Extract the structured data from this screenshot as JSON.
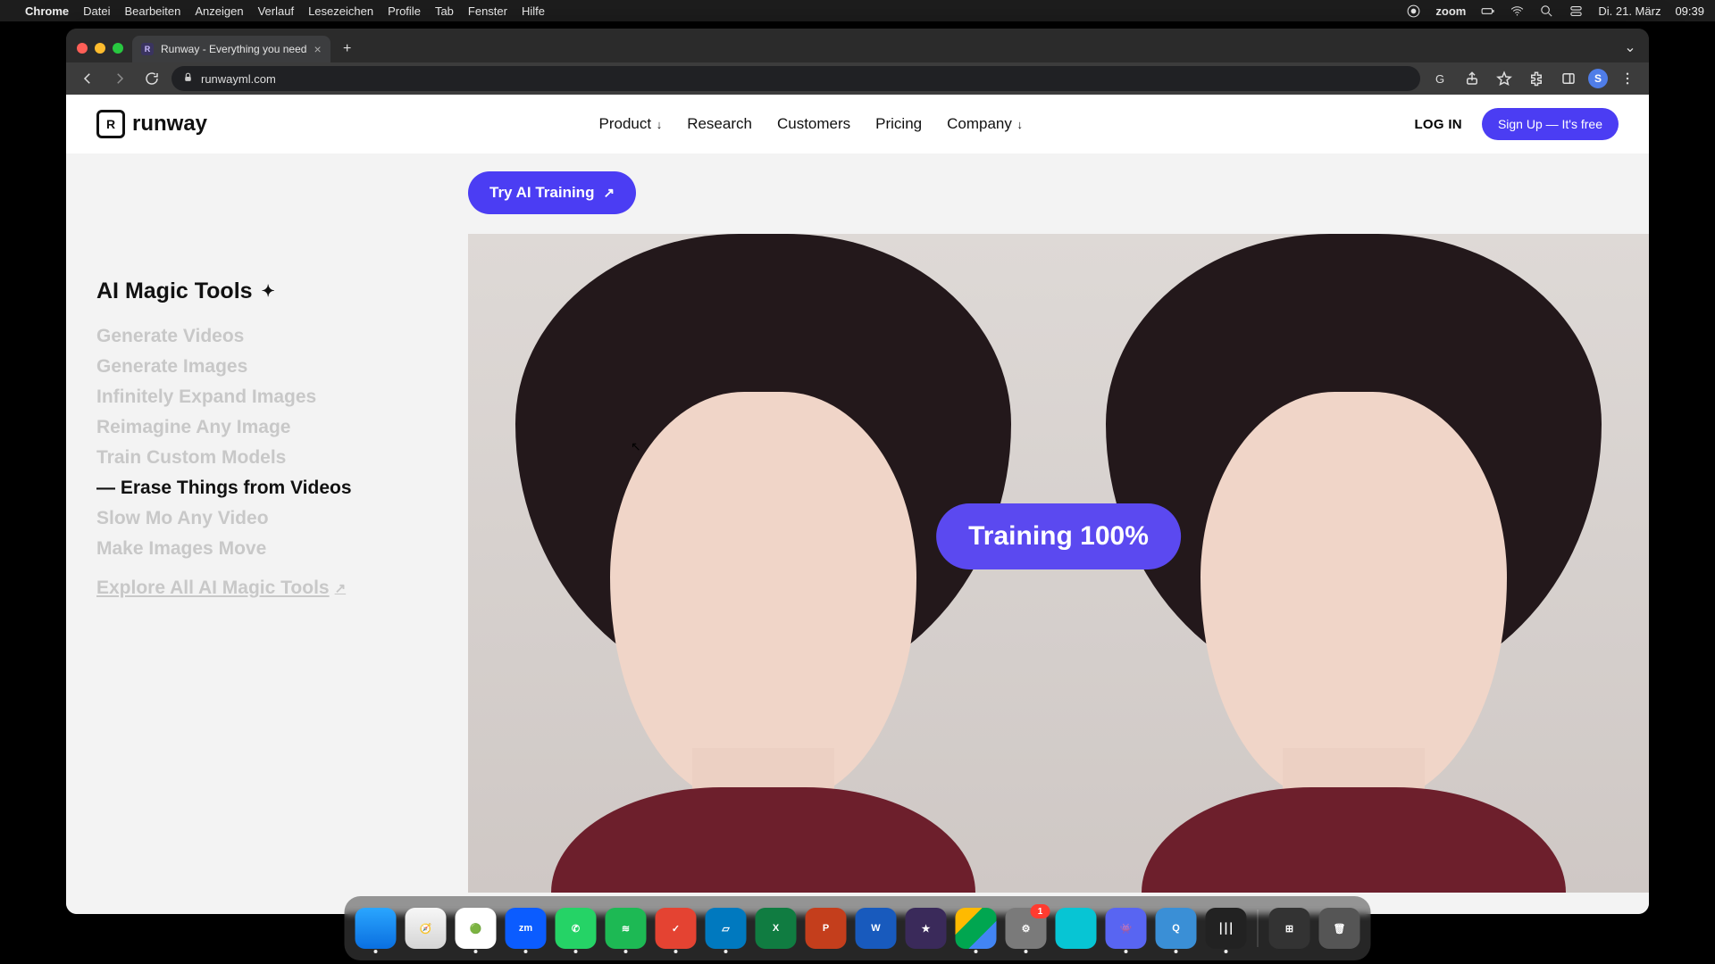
{
  "menubar": {
    "app": "Chrome",
    "items": [
      "Datei",
      "Bearbeiten",
      "Anzeigen",
      "Verlauf",
      "Lesezeichen",
      "Profile",
      "Tab",
      "Fenster",
      "Hilfe"
    ],
    "right": {
      "zoom": "zoom",
      "date": "Di. 21. März",
      "time": "09:39"
    }
  },
  "chrome": {
    "tab_title": "Runway - Everything you need",
    "url": "runwayml.com",
    "avatar": "S"
  },
  "site": {
    "brand": "runway",
    "nav": {
      "product": "Product",
      "research": "Research",
      "customers": "Customers",
      "pricing": "Pricing",
      "company": "Company"
    },
    "login": "LOG IN",
    "signup": "Sign Up — It's free"
  },
  "cta": "Try AI Training",
  "sidebar": {
    "title": "AI Magic Tools",
    "items": [
      {
        "label": "Generate Videos",
        "active": false
      },
      {
        "label": "Generate Images",
        "active": false
      },
      {
        "label": "Infinitely Expand Images",
        "active": false
      },
      {
        "label": "Reimagine Any Image",
        "active": false
      },
      {
        "label": "Train Custom Models",
        "active": false
      },
      {
        "label": "Erase Things from Videos",
        "active": true
      },
      {
        "label": "Slow Mo Any Video",
        "active": false
      },
      {
        "label": "Make Images Move",
        "active": false
      }
    ],
    "explore": "Explore All AI Magic Tools"
  },
  "hero": {
    "training_label": "Training 100%"
  },
  "dock": {
    "apps": [
      {
        "name": "Finder",
        "bg": "linear-gradient(180deg,#2aa6ff,#0a6fe0)",
        "glyph": "",
        "running": true
      },
      {
        "name": "Safari",
        "bg": "linear-gradient(180deg,#f7f7f7,#d5d5d5)",
        "glyph": "🧭",
        "running": false
      },
      {
        "name": "Chrome",
        "bg": "#fff",
        "glyph": "🟢",
        "running": true
      },
      {
        "name": "Zoom",
        "bg": "#0b5cff",
        "glyph": "zm",
        "running": true
      },
      {
        "name": "WhatsApp",
        "bg": "#25d366",
        "glyph": "✆",
        "running": true
      },
      {
        "name": "Spotify",
        "bg": "#1db954",
        "glyph": "≋",
        "running": true
      },
      {
        "name": "Todoist",
        "bg": "#e44332",
        "glyph": "✓",
        "running": true
      },
      {
        "name": "Trello",
        "bg": "#0079bf",
        "glyph": "▱",
        "running": true
      },
      {
        "name": "Excel",
        "bg": "#107c41",
        "glyph": "X",
        "running": false
      },
      {
        "name": "PowerPoint",
        "bg": "#c43e1c",
        "glyph": "P",
        "running": false
      },
      {
        "name": "Word",
        "bg": "#185abd",
        "glyph": "W",
        "running": false
      },
      {
        "name": "iMovie",
        "bg": "#3a2a5a",
        "glyph": "★",
        "running": false
      },
      {
        "name": "Drive",
        "bg": "linear-gradient(135deg,#ffba00 33%,#00a650 33% 66%,#4285f4 66%)",
        "glyph": "",
        "running": true
      },
      {
        "name": "Settings",
        "bg": "#7a7a7a",
        "glyph": "⚙",
        "running": true,
        "badge": "1"
      },
      {
        "name": "App",
        "bg": "#07c5d4",
        "glyph": "",
        "running": false
      },
      {
        "name": "Discord",
        "bg": "#5865f2",
        "glyph": "👾",
        "running": true
      },
      {
        "name": "QuickTime",
        "bg": "#3a8fd6",
        "glyph": "Q",
        "running": true
      },
      {
        "name": "VoiceMemos",
        "bg": "#222",
        "glyph": "⎮⎮⎮",
        "running": true
      }
    ],
    "extras": [
      {
        "name": "Calculator",
        "bg": "#333",
        "glyph": "⊞"
      },
      {
        "name": "Trash",
        "bg": "#555",
        "glyph": "🗑"
      }
    ]
  }
}
